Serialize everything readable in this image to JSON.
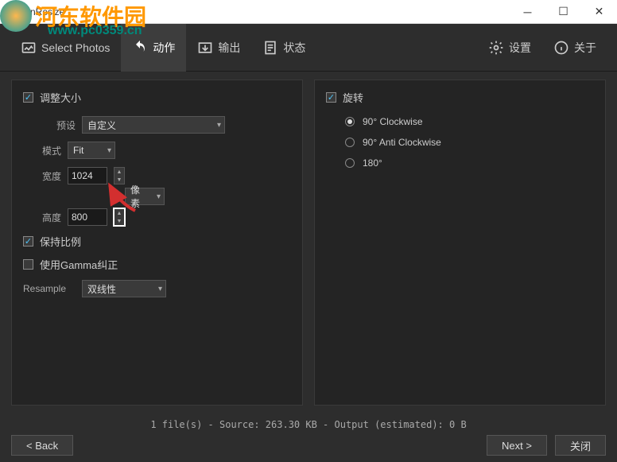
{
  "window": {
    "title": "XnResize"
  },
  "watermark": {
    "text": "河东软件园",
    "url": "www.pc0359.cn"
  },
  "toolbar": {
    "tabs": [
      {
        "label": "Select Photos"
      },
      {
        "label": "动作"
      },
      {
        "label": "输出"
      },
      {
        "label": "状态"
      }
    ],
    "settings": "设置",
    "about": "关于"
  },
  "resize": {
    "title": "调整大小",
    "preset_label": "预设",
    "preset_value": "自定义",
    "mode_label": "模式",
    "mode_value": "Fit",
    "width_label": "宽度",
    "width_value": "1024",
    "height_label": "高度",
    "height_value": "800",
    "unit_value": "像素",
    "keep_ratio": "保持比例",
    "gamma": "使用Gamma纠正",
    "resample_label": "Resample",
    "resample_value": "双线性"
  },
  "rotate": {
    "title": "旋转",
    "options": [
      "90°  Clockwise",
      "90°  Anti Clockwise",
      "180°"
    ]
  },
  "status": "1 file(s) - Source: 263.30 KB - Output (estimated): 0 B",
  "footer": {
    "back": "< Back",
    "next": "Next >",
    "close": "关闭"
  }
}
